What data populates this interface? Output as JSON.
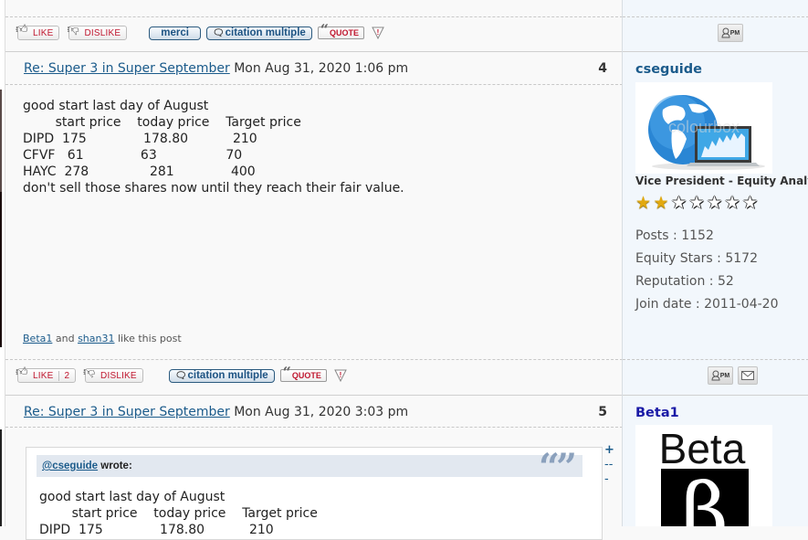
{
  "prev_actions": {
    "like_label": "LIKE",
    "dislike_label": "DISLIKE",
    "merci_label": "merci",
    "multiquote_label": "citation multiple",
    "quote_label": "QUOTE",
    "pm_label": "PM"
  },
  "posts": [
    {
      "title": "Re: Super 3 in Super September",
      "date": "Mon Aug 31, 2020 1:06 pm",
      "number": "4",
      "content": "good start last day of August\n        start price    today price    Target price\nDIPD  175              178.80           210\nCFVF   61              63                 70\nHAYC  278               281              400\ndon't sell those shares now until they reach their fair value.",
      "likers": [
        "Beta1",
        "shan31"
      ],
      "likers_and": "and",
      "likers_suffix": "like this post",
      "actions": {
        "like_label": "LIKE",
        "like_count": "2",
        "dislike_label": "DISLIKE",
        "multiquote_label": "citation multiple",
        "quote_label": "QUOTE",
        "pm_label": "PM"
      },
      "author": {
        "name": "cseguide",
        "name_color": "#1b5b8b",
        "rank": "Vice President - Equity Analyst",
        "stars_filled": 2,
        "stars_total": 7,
        "stats": [
          {
            "label": "Posts",
            "value": "1152"
          },
          {
            "label": "Equity Stars",
            "value": "5172"
          },
          {
            "label": "Reputation",
            "value": "52"
          },
          {
            "label": "Join date",
            "value": "2011-04-20"
          }
        ]
      }
    },
    {
      "title": "Re: Super 3 in Super September",
      "date": "Mon Aug 31, 2020 3:03 pm",
      "number": "5",
      "quote": {
        "author": "@cseguide",
        "wrote": "wrote:",
        "content": "good start last day of August\n        start price    today price    Target price\nDIPD  175              178.80           210"
      },
      "expand_controls": [
        "+",
        "--",
        "-"
      ],
      "author": {
        "name": "Beta1",
        "name_color": "#1a1aa6",
        "avatar_text": "Beta"
      }
    }
  ]
}
